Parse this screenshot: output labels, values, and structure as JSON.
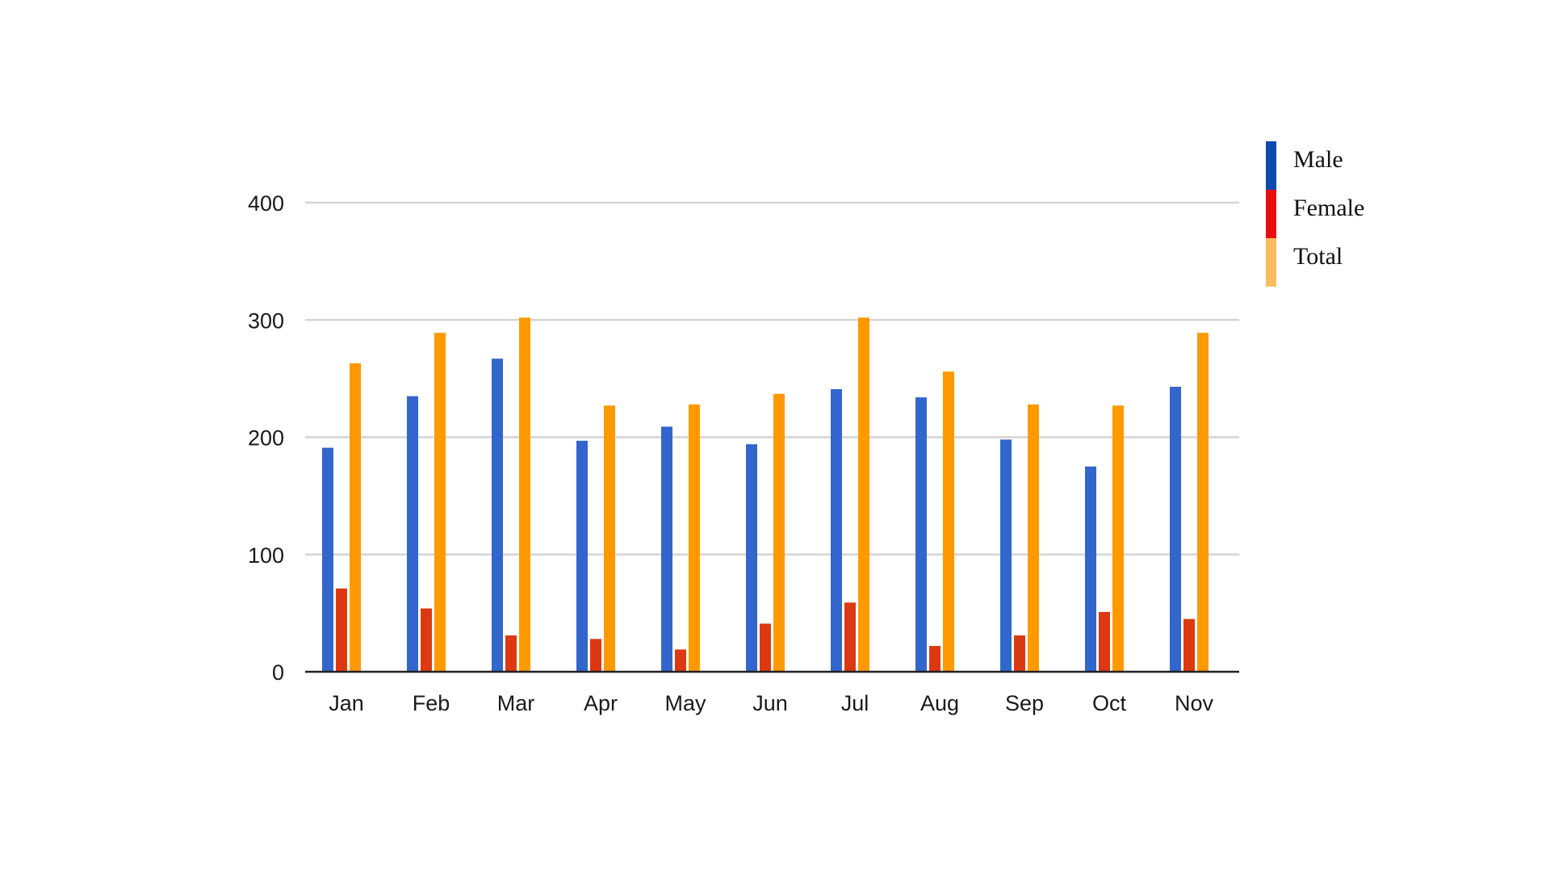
{
  "chart_data": {
    "type": "bar",
    "title": "",
    "xlabel": "",
    "ylabel": "",
    "categories": [
      "Jan",
      "Feb",
      "Mar",
      "Apr",
      "May",
      "Jun",
      "Jul",
      "Aug",
      "Sep",
      "Oct",
      "Nov"
    ],
    "series": [
      {
        "name": "Male",
        "color": "#3366cc",
        "legend_color": "#0b4ab0",
        "values": [
          191,
          235,
          267,
          197,
          209,
          194,
          241,
          234,
          198,
          175,
          243
        ]
      },
      {
        "name": "Female",
        "color": "#dc3912",
        "legend_color": "#e8100f",
        "values": [
          71,
          54,
          31,
          28,
          19,
          41,
          59,
          22,
          31,
          51,
          45
        ]
      },
      {
        "name": "Total",
        "color": "#ff9900",
        "legend_color": "#fcbd5f",
        "values": [
          263,
          289,
          302,
          227,
          228,
          237,
          302,
          256,
          228,
          227,
          289
        ]
      }
    ],
    "ylim": [
      0,
      400
    ],
    "yticks": [
      0,
      100,
      200,
      300,
      400
    ],
    "ytick_labels": [
      "0",
      "100",
      "200",
      "300",
      "400"
    ],
    "grid": true,
    "legend_position": "top-right"
  },
  "legend": {
    "items": [
      {
        "label": "Male",
        "color": "#0b4ab0"
      },
      {
        "label": "Female",
        "color": "#e8100f"
      },
      {
        "label": "Total",
        "color": "#fcbd5f"
      }
    ]
  }
}
